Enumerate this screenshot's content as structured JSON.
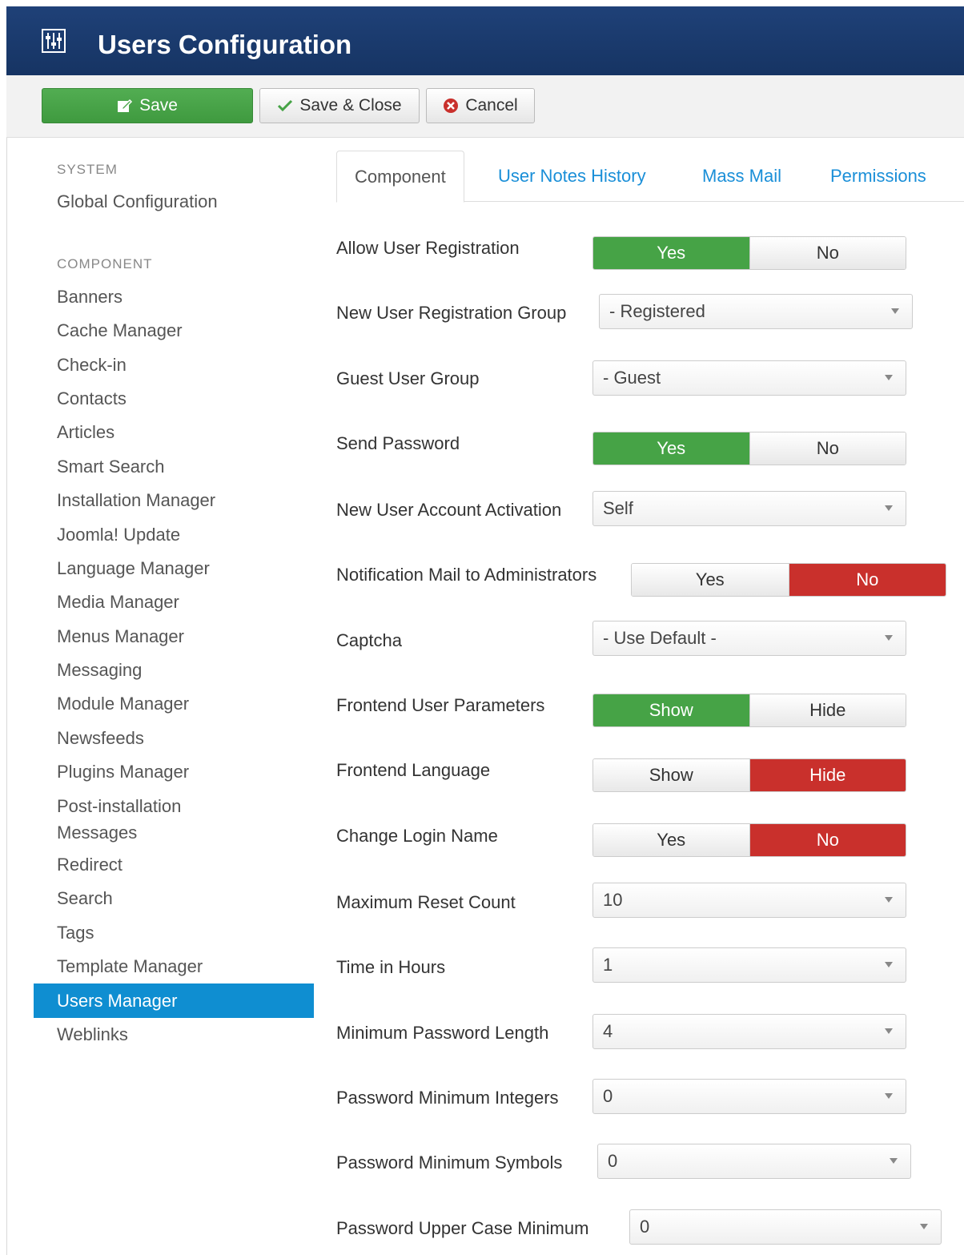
{
  "header": {
    "title": "Users Configuration",
    "icon": "equalizer-icon"
  },
  "toolbar": {
    "save_label": "Save",
    "save_close_label": "Save & Close",
    "cancel_label": "Cancel"
  },
  "sidebar": {
    "system_header": "SYSTEM",
    "global_configuration": "Global Configuration",
    "component_header": "COMPONENT",
    "items": [
      "Banners",
      "Cache Manager",
      "Check-in",
      "Contacts",
      "Articles",
      "Smart Search",
      "Installation Manager",
      "Joomla! Update",
      "Language Manager",
      "Media Manager",
      "Menus Manager",
      "Messaging",
      "Module Manager",
      "Newsfeeds",
      "Plugins Manager",
      "Post-installation",
      "Messages",
      "Redirect",
      "Search",
      "Tags",
      "Template Manager",
      "Users Manager",
      "Weblinks"
    ],
    "active": "Users Manager"
  },
  "tabs": [
    "Component",
    "User Notes History",
    "Mass Mail",
    "Permissions"
  ],
  "fields": {
    "allow_registration": {
      "label": "Allow User Registration",
      "options": [
        "Yes",
        "No"
      ],
      "selected": "Yes"
    },
    "new_user_group": {
      "label": "New User Registration Group",
      "value": "- Registered"
    },
    "guest_group": {
      "label": "Guest User Group",
      "value": "- Guest"
    },
    "send_password": {
      "label": "Send Password",
      "options": [
        "Yes",
        "No"
      ],
      "selected": "Yes"
    },
    "account_activation": {
      "label": "New User Account Activation",
      "value": "Self"
    },
    "notification_mail": {
      "label": "Notification Mail to Administrators",
      "options": [
        "Yes",
        "No"
      ],
      "selected": "No"
    },
    "captcha": {
      "label": "Captcha",
      "value": "- Use Default -"
    },
    "frontend_params": {
      "label": "Frontend User Parameters",
      "options": [
        "Show",
        "Hide"
      ],
      "selected": "Show"
    },
    "frontend_language": {
      "label": "Frontend Language",
      "options": [
        "Show",
        "Hide"
      ],
      "selected": "Hide"
    },
    "change_login": {
      "label": "Change Login Name",
      "options": [
        "Yes",
        "No"
      ],
      "selected": "No"
    },
    "max_reset": {
      "label": "Maximum Reset Count",
      "value": "10"
    },
    "time_hours": {
      "label": "Time in Hours",
      "value": "1"
    },
    "min_pw_length": {
      "label": "Minimum Password Length",
      "value": "4"
    },
    "pw_min_integers": {
      "label": "Password Minimum Integers",
      "value": "0"
    },
    "pw_min_symbols": {
      "label": "Password Minimum Symbols",
      "value": "0"
    },
    "pw_upper_min": {
      "label": "Password Upper Case Minimum",
      "value": "0"
    }
  },
  "colors": {
    "header_bg": "#1a3867",
    "save_green": "#46a346",
    "toggle_red": "#c9302c",
    "active_blue": "#0f8ed1",
    "link_blue": "#1a8fd8"
  }
}
